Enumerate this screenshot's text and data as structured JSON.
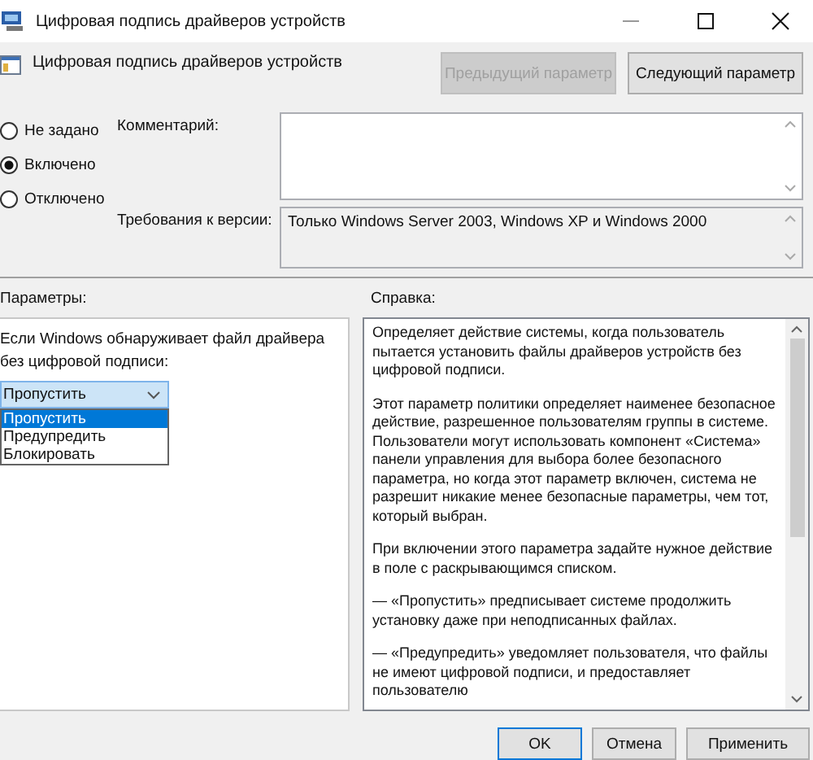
{
  "window": {
    "title": "Цифровая подпись драйверов устройств"
  },
  "policy": {
    "title": "Цифровая подпись драйверов устройств"
  },
  "nav_buttons": [
    {
      "label": "Предыдущий параметр",
      "disabled": true
    },
    {
      "label": "Следующий параметр",
      "disabled": false
    }
  ],
  "state_options": [
    {
      "label": "Не задано",
      "selected": false
    },
    {
      "label": "Включено",
      "selected": true
    },
    {
      "label": "Отключено",
      "selected": false
    }
  ],
  "comment": {
    "label": "Комментарий:"
  },
  "requirements": {
    "label": "Требования к версии:",
    "value": "Только Windows Server 2003, Windows XP и Windows 2000"
  },
  "options": {
    "label": "Параметры:",
    "prompt": "Если Windows обнаруживает файл драйвера без цифровой подписи:",
    "dropdown": {
      "value": "Пропустить",
      "expanded": true,
      "items": [
        {
          "label": "Пропустить",
          "selected": true
        },
        {
          "label": "Предупредить",
          "selected": false
        },
        {
          "label": "Блокировать",
          "selected": false
        }
      ]
    }
  },
  "help": {
    "label": "Справка:",
    "paragraphs": [
      "Определяет действие системы, когда пользователь пытается установить файлы драйверов устройств без цифровой подписи.",
      "Этот параметр политики определяет наименее безопасное действие, разрешенное пользователям группы в системе. Пользователи могут использовать компонент «Система» панели управления для выбора более безопасного параметра, но когда этот параметр включен, система не разрешит никакие менее безопасные параметры, чем тот, который выбран.",
      "При включении этого параметра задайте нужное действие в поле с раскрывающимся списком.",
      "— «Пропустить» предписывает системе продолжить установку даже при неподписанных файлах.",
      "— «Предупредить» уведомляет пользователя, что файлы не имеют цифровой подписи, и предоставляет пользователю"
    ]
  },
  "buttons": [
    {
      "label": "OK",
      "default": true
    },
    {
      "label": "Отмена",
      "default": false
    },
    {
      "label": "Применить",
      "default": false
    }
  ]
}
